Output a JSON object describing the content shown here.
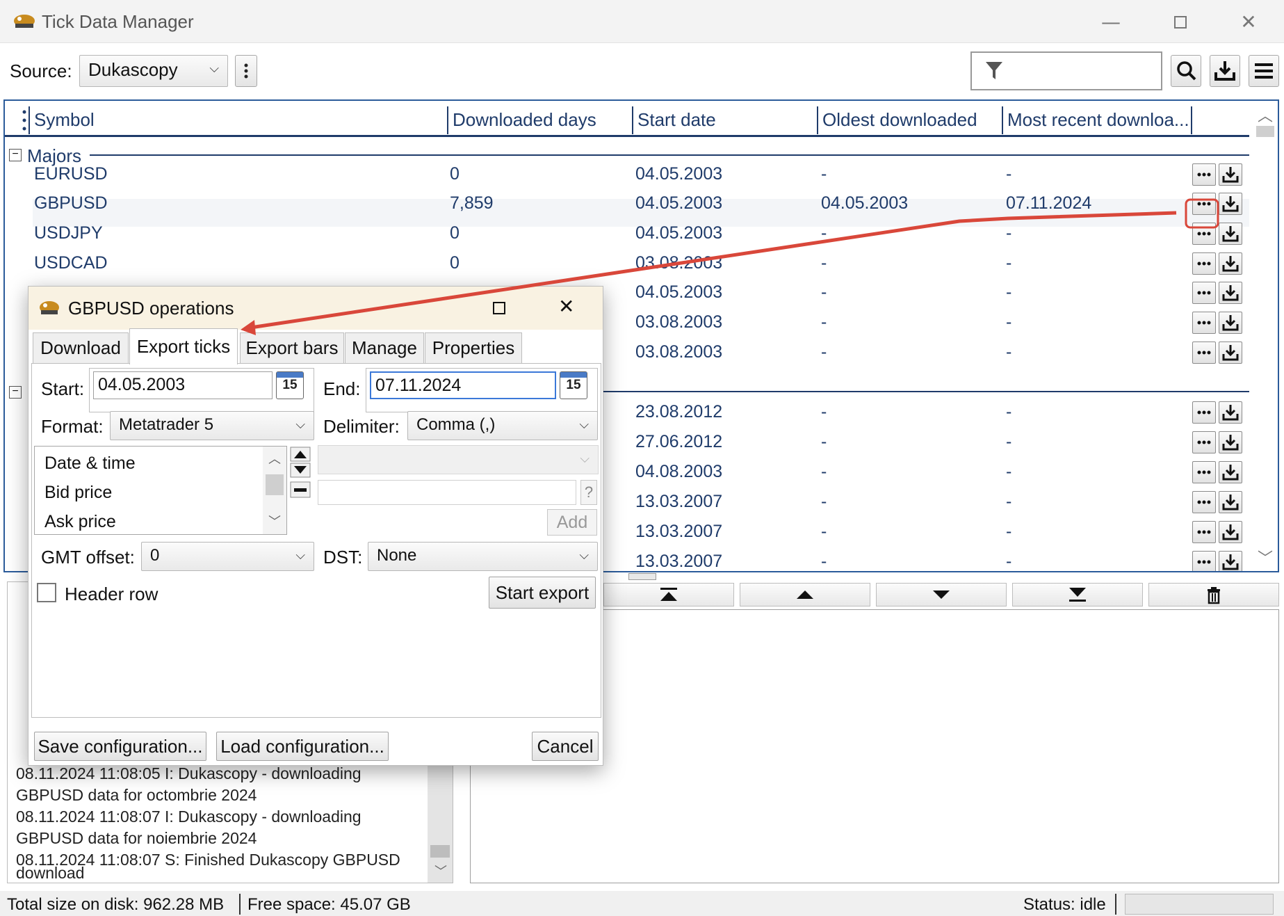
{
  "window": {
    "title": "Tick Data Manager"
  },
  "toolbar": {
    "source_label": "Source:",
    "source_value": "Dukascopy",
    "filter_value": ""
  },
  "grid": {
    "columns": [
      "Symbol",
      "Downloaded days",
      "Start date",
      "Oldest downloaded",
      "Most recent downloa..."
    ],
    "groups": [
      {
        "name": "Majors"
      }
    ],
    "rows": [
      {
        "symbol": "EURUSD",
        "days": "0",
        "start": "04.05.2003",
        "oldest": "-",
        "recent": "-"
      },
      {
        "symbol": "GBPUSD",
        "days": "7,859",
        "start": "04.05.2003",
        "oldest": "04.05.2003",
        "recent": "07.11.2024"
      },
      {
        "symbol": "USDJPY",
        "days": "0",
        "start": "04.05.2003",
        "oldest": "-",
        "recent": "-"
      },
      {
        "symbol": "USDCAD",
        "days": "0",
        "start": "03.08.2003",
        "oldest": "-",
        "recent": "-"
      },
      {
        "symbol": "",
        "days": "",
        "start": "04.05.2003",
        "oldest": "-",
        "recent": "-"
      },
      {
        "symbol": "",
        "days": "",
        "start": "03.08.2003",
        "oldest": "-",
        "recent": "-"
      },
      {
        "symbol": "",
        "days": "",
        "start": "03.08.2003",
        "oldest": "-",
        "recent": "-"
      },
      {
        "symbol": "",
        "days": "",
        "start": "23.08.2012",
        "oldest": "-",
        "recent": "-"
      },
      {
        "symbol": "",
        "days": "",
        "start": "27.06.2012",
        "oldest": "-",
        "recent": "-"
      },
      {
        "symbol": "",
        "days": "",
        "start": "04.08.2003",
        "oldest": "-",
        "recent": "-"
      },
      {
        "symbol": "",
        "days": "",
        "start": "13.03.2007",
        "oldest": "-",
        "recent": "-"
      },
      {
        "symbol": "",
        "days": "",
        "start": "13.03.2007",
        "oldest": "-",
        "recent": "-"
      },
      {
        "symbol": "",
        "days": "",
        "start": "13.03.2007",
        "oldest": "-",
        "recent": "-"
      }
    ]
  },
  "dialog": {
    "title": "GBPUSD operations",
    "tabs": [
      "Download",
      "Export ticks",
      "Export bars",
      "Manage",
      "Properties"
    ],
    "active_tab": "Export ticks",
    "start_label": "Start:",
    "start_value": "04.05.2003",
    "end_label": "End:",
    "end_value": "07.11.2024",
    "calendar_day": "15",
    "format_label": "Format:",
    "format_value": "Metatrader 5",
    "delimiter_label": "Delimiter:",
    "delimiter_value": "Comma (,)",
    "fields": [
      "Date & time",
      "Bid price",
      "Ask price"
    ],
    "help_label": "?",
    "add_label": "Add",
    "gmt_label": "GMT offset:",
    "gmt_value": "0",
    "dst_label": "DST:",
    "dst_value": "None",
    "header_row_label": "Header row",
    "header_row_checked": false,
    "start_export_label": "Start export",
    "save_config_label": "Save configuration...",
    "load_config_label": "Load configuration...",
    "cancel_label": "Cancel"
  },
  "log": {
    "lines": [
      "08.11.2024 11:08:05  I: Dukascopy - downloading",
      "GBPUSD data for octombrie 2024",
      "08.11.2024 11:08:07  I: Dukascopy - downloading",
      "GBPUSD data for noiembrie 2024",
      "08.11.2024 11:08:07  S: Finished Dukascopy GBPUSD",
      "download"
    ]
  },
  "statusbar": {
    "total_size": "Total size on disk: 962.28 MB",
    "free_space": "Free space: 45.07 GB",
    "status": "Status: idle"
  },
  "colors": {
    "accent": "#1f3b6a",
    "annotation": "#d9473a",
    "grid_border": "#2b5b9a"
  }
}
